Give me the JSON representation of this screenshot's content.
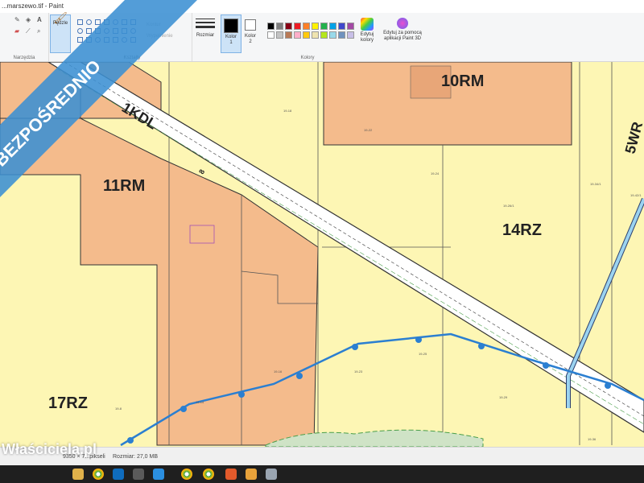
{
  "window": {
    "title": "...marszewo.tif - Paint"
  },
  "ribbon": {
    "group_tools": "Narzędzia",
    "brush_label": "Pędzle",
    "group_shapes": "Kształty",
    "outline_label": "Kontur",
    "fill_label": "Wypełnienie",
    "size_label": "Rozmiar",
    "color1_label": "Kolor",
    "color1_num": "1",
    "color2_label": "Kolor",
    "color2_num": "2",
    "group_colors": "Kolory",
    "edit_colors": "Edytuj kolory",
    "paint3d": "Edytuj za pomocą aplikacji Paint 3D",
    "palette": [
      "#000000",
      "#7f7f7f",
      "#880015",
      "#ed1c24",
      "#ff7f27",
      "#fff200",
      "#22b14c",
      "#00a2e8",
      "#3f48cc",
      "#a349a4",
      "#ffffff",
      "#c3c3c3",
      "#b97a57",
      "#ffaec9",
      "#ffc90e",
      "#efe4b0",
      "#b5e61d",
      "#99d9ea",
      "#7092be",
      "#c8bfe7"
    ]
  },
  "map": {
    "zones": [
      "10RM",
      "11RM",
      "14RZ",
      "17RZ",
      "1KDL",
      "5WR"
    ],
    "road_number": "8",
    "parcels": [
      "19-22",
      "19-24",
      "19-26/1",
      "19-34/1",
      "19-42/1",
      "19-16",
      "19-14",
      "19-23",
      "19-25",
      "19-29",
      "19-36",
      "19-8",
      "19-18"
    ]
  },
  "banner": {
    "text": "BEZPOŚREDNIO"
  },
  "watermark": {
    "text": "Właściciela.pl"
  },
  "status": {
    "dims": "9350 × 7...pikseli",
    "size": "Rozmiar: 27,0 MB"
  },
  "colors": {
    "ribbon_blue": "#3b8fd3",
    "zone_rm": "#f4bb8c",
    "zone_rz": "#fdf6b4",
    "river": "#2b7fd1"
  }
}
